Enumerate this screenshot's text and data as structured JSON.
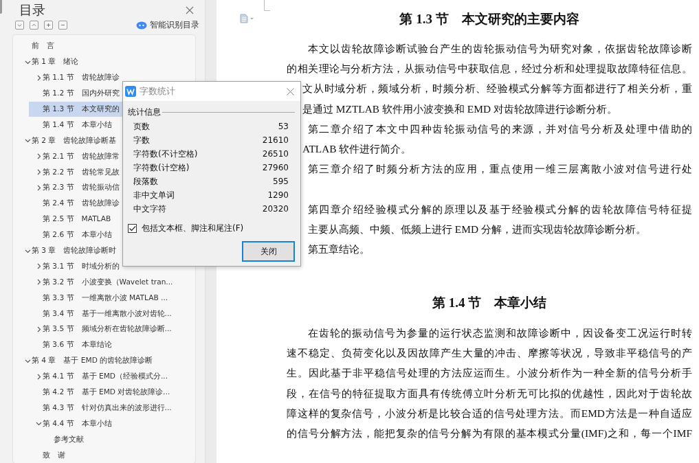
{
  "sidebar": {
    "title": "目录",
    "smart_button": "智能识别目录",
    "toc": [
      {
        "label": "前　言",
        "kind": "leaf",
        "selected": false
      },
      {
        "label": "第 1 章　绪论",
        "kind": "branch",
        "expanded": true,
        "selected": false,
        "children": [
          {
            "label": "第 1.1 节　齿轮故障诊",
            "kind": "branch",
            "expanded": false,
            "selected": false
          },
          {
            "label": "第 1.2 节　国内外研究",
            "kind": "leaf",
            "selected": false
          },
          {
            "label": "第 1.3 节　本文研究的",
            "kind": "leaf",
            "selected": true
          },
          {
            "label": "第 1.4 节　本章小结",
            "kind": "leaf",
            "selected": false
          }
        ]
      },
      {
        "label": "第 2 章　齿轮故障诊断基",
        "kind": "branch",
        "expanded": true,
        "selected": false,
        "children": [
          {
            "label": "第 2.1 节　齿轮故障常",
            "kind": "branch",
            "expanded": false,
            "selected": false
          },
          {
            "label": "第 2.2 节　齿轮常见故",
            "kind": "branch",
            "expanded": false,
            "selected": false
          },
          {
            "label": "第 2.3 节　齿轮振动信",
            "kind": "branch",
            "expanded": false,
            "selected": false
          },
          {
            "label": "第 2.4 节　齿轮故障诊",
            "kind": "leaf",
            "selected": false
          },
          {
            "label": "第 2.5 节　MATLAB",
            "kind": "leaf",
            "selected": false
          },
          {
            "label": "第 2.6 节　本章小结",
            "kind": "leaf",
            "selected": false
          }
        ]
      },
      {
        "label": "第 3 章　齿轮故障诊断时",
        "kind": "branch",
        "expanded": true,
        "selected": false,
        "children": [
          {
            "label": "第 3.1 节　时域分析的",
            "kind": "branch",
            "expanded": false,
            "selected": false
          },
          {
            "label": "第 3.2 节　小波变换（Wavelet tran...",
            "kind": "branch",
            "expanded": false,
            "selected": false
          },
          {
            "label": "第 3.3 节　一维离散小波 MATLAB ...",
            "kind": "leaf",
            "selected": false
          },
          {
            "label": "第 3.4 节　基于一维离散小波对齿轮...",
            "kind": "leaf",
            "selected": false
          },
          {
            "label": "第 3.5 节　频域分析在齿轮故障诊断...",
            "kind": "branch",
            "expanded": false,
            "selected": false
          },
          {
            "label": "第 3.6 节　本章结论",
            "kind": "leaf",
            "selected": false
          }
        ]
      },
      {
        "label": "第 4 章　基于 EMD 的齿轮故障诊断",
        "kind": "branch",
        "expanded": true,
        "selected": false,
        "children": [
          {
            "label": "第 4.1 节　基于 EMD（经验模式分...",
            "kind": "branch",
            "expanded": false,
            "selected": false
          },
          {
            "label": "第 4.2 节　基于 EMD 对齿轮故障诊...",
            "kind": "leaf",
            "selected": false
          },
          {
            "label": "第 4.3 节　针对仿真出来的波形进行...",
            "kind": "leaf",
            "selected": false
          },
          {
            "label": "第 4.4 节　本章小结",
            "kind": "branch",
            "expanded": true,
            "selected": false,
            "children": [
              {
                "label": "参考文献",
                "kind": "leaf",
                "selected": false
              }
            ]
          },
          {
            "label": "致　谢",
            "kind": "leaf",
            "selected": false
          }
        ]
      }
    ]
  },
  "document": {
    "sections": [
      {
        "heading": "第 1.3 节　本文研究的主要内容",
        "lines": [
          {
            "kind": "indent",
            "last": false,
            "text": "本文以齿轮故障诊断试验台产生的齿轮振动信号为研究对象，依据齿轮故障诊断"
          },
          {
            "kind": "flush",
            "last": false,
            "text": "的相关理论与分析方法，从振动信号中获取信息，经过分析和处理提取故障特征信息。"
          },
          {
            "kind": "covered",
            "last": false,
            "text": "文从时域分析，频域分析，时频分析、经验模式分解等方面都进行了相关分析，重"
          },
          {
            "kind": "covered",
            "last": true,
            "text": "是通过 MZTLAB 软件用小波变换和 EMD 对齿轮故障进行诊断分析。"
          },
          {
            "kind": "indent",
            "last": false,
            "text": "第二章介绍了本文中四种齿轮振动信号的来源，并对信号分析及处理中借助的"
          },
          {
            "kind": "covered",
            "last": true,
            "text": "ATLAB 软件进行简介。"
          },
          {
            "kind": "indent",
            "last": false,
            "text": "第三章介绍了时频分析方法的应用，重点使用一维三层离散小波对信号进行处"
          },
          {
            "kind": "gap"
          },
          {
            "kind": "indent",
            "last": false,
            "text": "第四章介绍经验模式分解的原理以及基于经验模式分解的齿轮故障信号特征提"
          },
          {
            "kind": "indent",
            "last": true,
            "text": "主要从高频、中频、低频上进行 EMD 分解，进而实现齿轮故障诊断分析。"
          },
          {
            "kind": "indent",
            "last": true,
            "text": "第五章结论。"
          }
        ]
      },
      {
        "heading": "第 1.4 节　本章小结",
        "lines": [
          {
            "kind": "indent",
            "last": false,
            "text": "在齿轮的振动信号为参量的运行状态监测和故障诊断中，因设备变工况运行时转"
          },
          {
            "kind": "flush",
            "last": false,
            "text": "速不稳定、负荷变化以及因故障产生大量的冲击、摩擦等状况，导致非平稳信号的产"
          },
          {
            "kind": "flush",
            "last": false,
            "text": "生。因此基于非平稳信号处理的方法应运而生。小波分析作为一种全新的信号分析手"
          },
          {
            "kind": "flush",
            "last": false,
            "text": "段，在信号的特征提取方面具有传统傅立叶分析无可比拟的优越性，因此对于齿轮故"
          },
          {
            "kind": "flush",
            "last": false,
            "text": "障这样的复杂信号，小波分析是比较合适的信号处理方法。而EMD方法是一种自适应"
          },
          {
            "kind": "flush",
            "last": false,
            "text": "的信号分解方法，能把复杂的信号分解为有限的基本模式分量(IMF)之和，每一个IMF"
          }
        ]
      }
    ]
  },
  "dialog": {
    "title": "字数统计",
    "group": "统计信息",
    "stats": [
      {
        "label": "页数",
        "value": "53"
      },
      {
        "label": "字数",
        "value": "21610"
      },
      {
        "label": "字符数(不计空格)",
        "value": "26510"
      },
      {
        "label": "字符数(计空格)",
        "value": "27960"
      },
      {
        "label": "段落数",
        "value": "595"
      },
      {
        "label": "非中文单词",
        "value": "1290"
      },
      {
        "label": "中文字符",
        "value": "20320"
      }
    ],
    "checkbox": {
      "label": "包括文本框、脚注和尾注(F)",
      "checked": true
    },
    "button": "关闭"
  }
}
